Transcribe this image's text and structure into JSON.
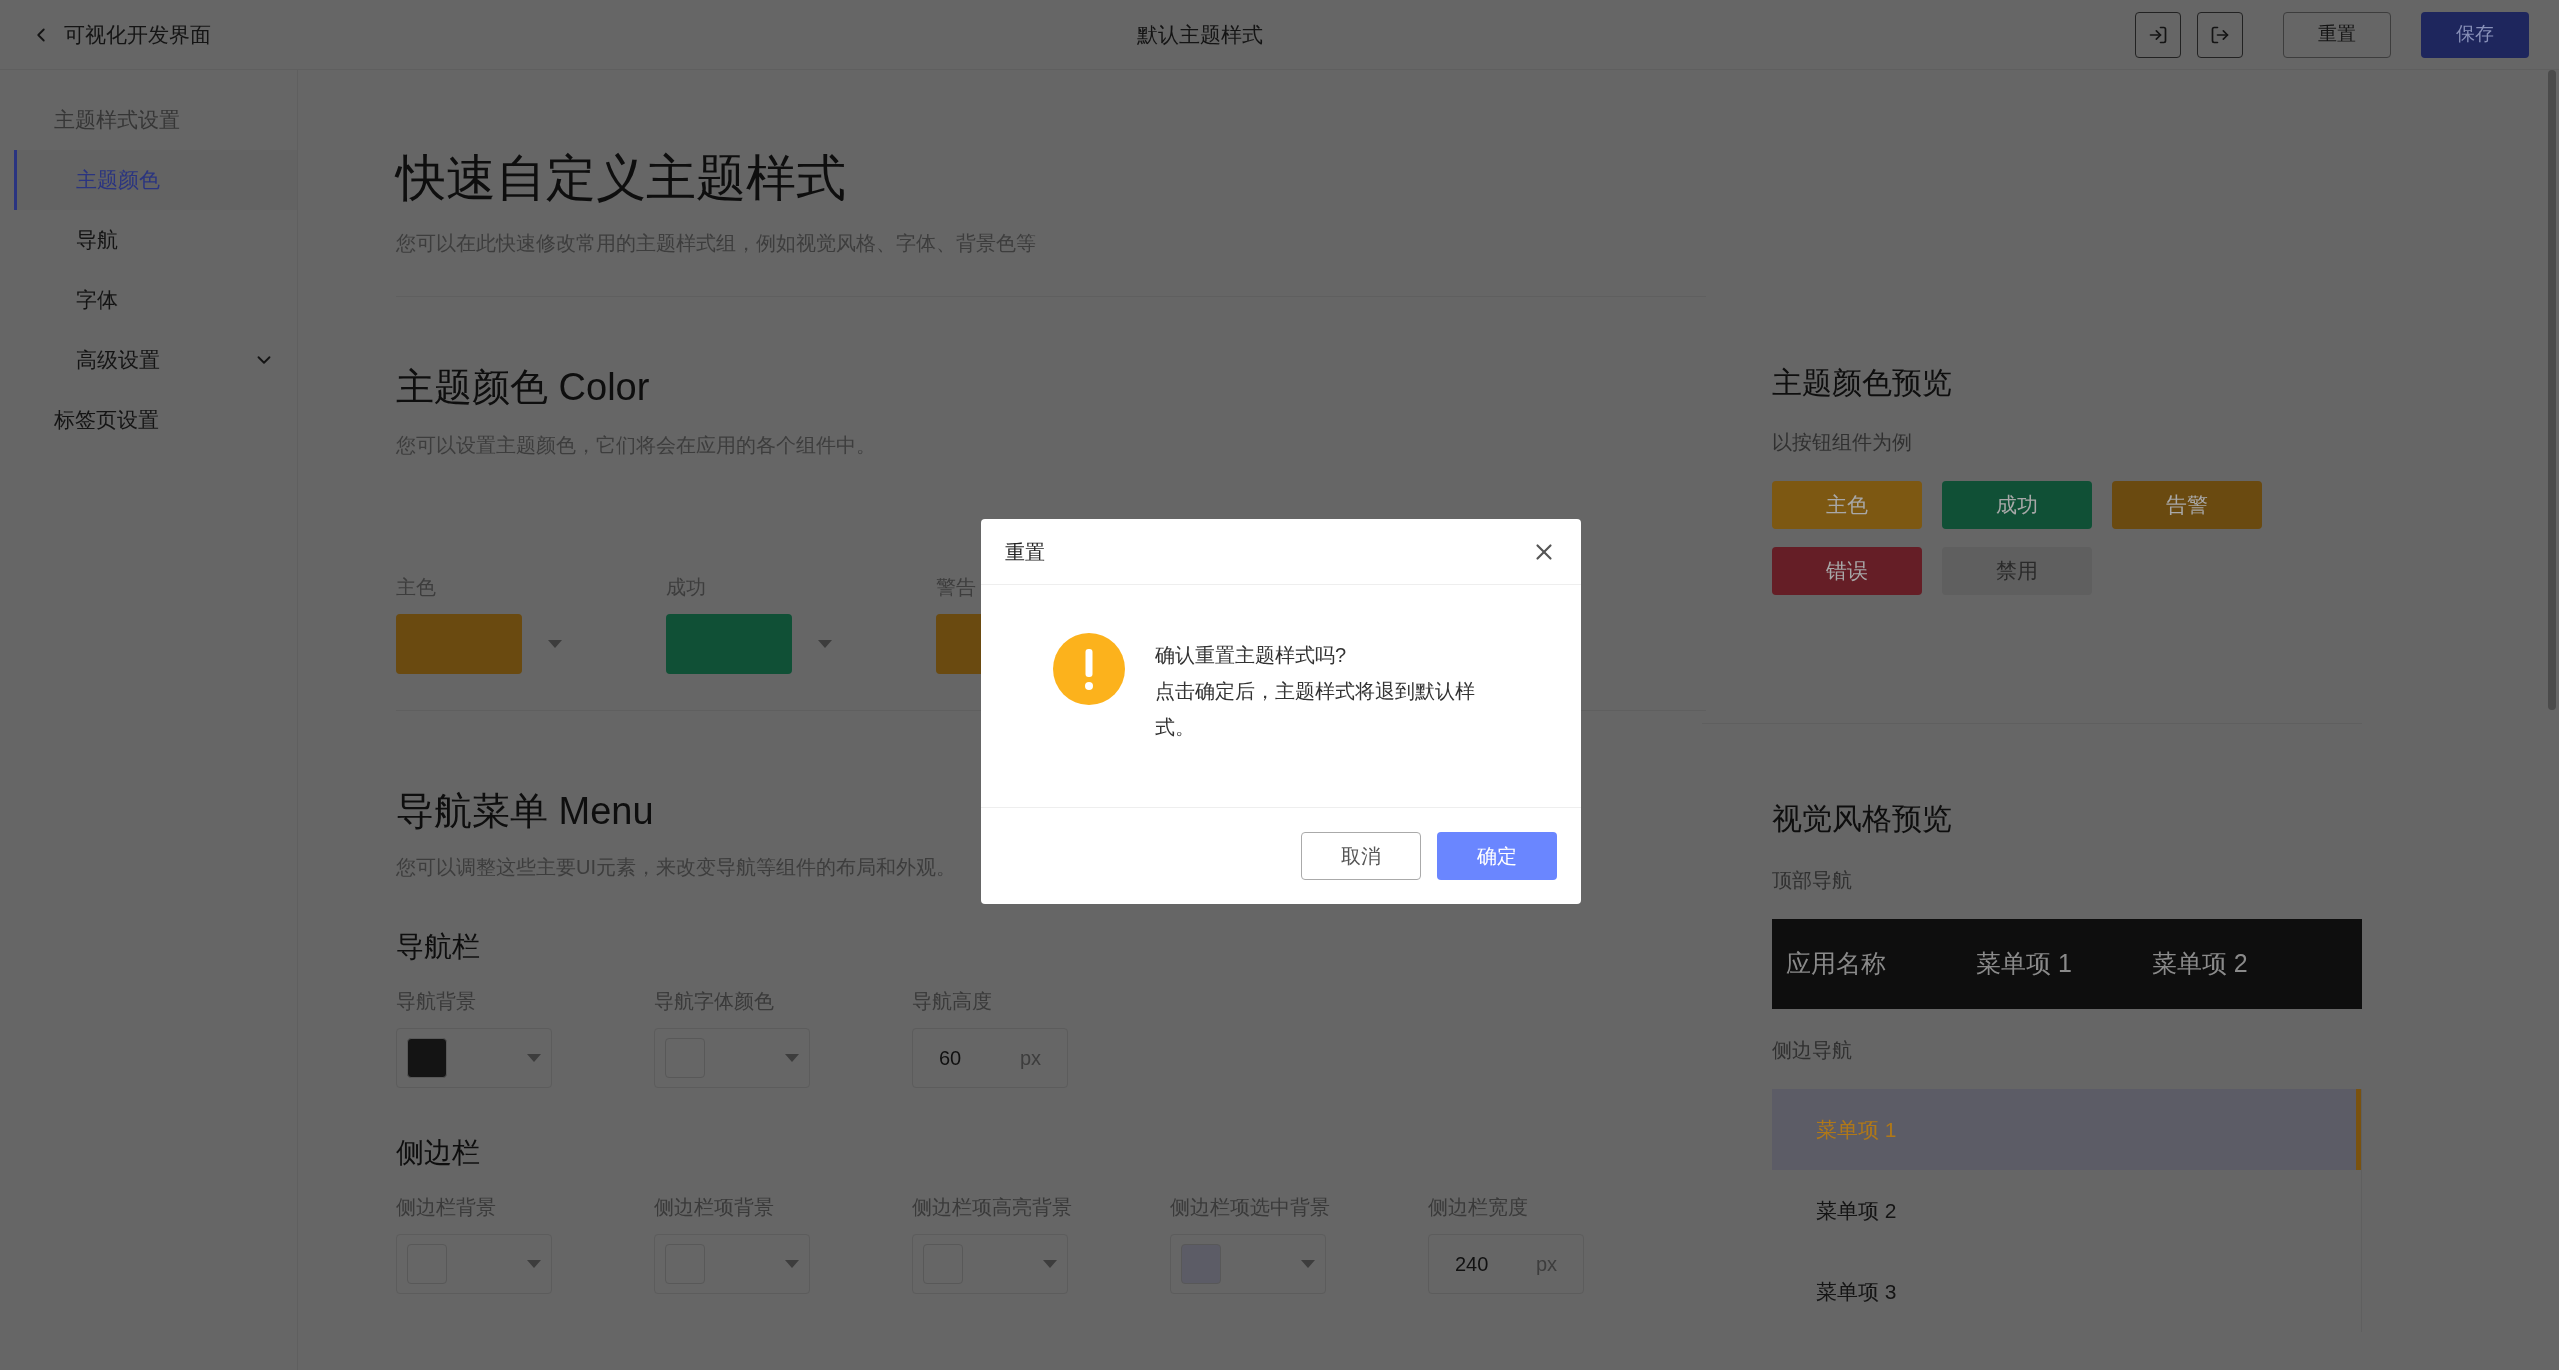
{
  "header": {
    "back_label": "可视化开发界面",
    "title": "默认主题样式",
    "icon_buttons": [
      {
        "kind": "import"
      },
      {
        "kind": "export"
      }
    ],
    "reset_label": "重置",
    "save_label": "保存"
  },
  "sidebar": {
    "items": [
      {
        "label": "主题样式设置",
        "children": [
          {
            "label": "主题颜色",
            "selected": true
          },
          {
            "label": "导航",
            "selected": false
          },
          {
            "label": "字体",
            "selected": false
          },
          {
            "label": "高级设置",
            "selected": false,
            "expanded": false
          }
        ]
      },
      {
        "label": "标签页设置"
      }
    ]
  },
  "intro": {
    "title": "快速自定义主题样式",
    "description": "您可以在此快速修改常用的主题样式组，例如视觉风格、字体、背景色等"
  },
  "color_section": {
    "title": "主题颜色 Color",
    "description": "您可以设置主题颜色，它们将会在应用的各个组件中。",
    "swatches": [
      {
        "label": "主色",
        "color": "#6a4a10"
      },
      {
        "label": "成功",
        "color": "#105036"
      },
      {
        "label": "警告",
        "color": "#6a4a10"
      }
    ]
  },
  "menu_section": {
    "title": "导航菜单 Menu",
    "description": "您可以调整这些主要UI元素，来改变导航等组件的布局和外观。",
    "groups": [
      {
        "title": "导航栏",
        "fields": [
          {
            "label": "导航背景",
            "kind": "color",
            "color": "#141414"
          },
          {
            "label": "导航字体颜色",
            "kind": "color",
            "color": "#666666"
          },
          {
            "label": "导航高度",
            "kind": "number",
            "value": "60",
            "unit": "px"
          }
        ]
      },
      {
        "title": "侧边栏",
        "fields": [
          {
            "label": "侧边栏背景",
            "kind": "color",
            "color": "#666666"
          },
          {
            "label": "侧边栏项背景",
            "kind": "color",
            "color": "#666666"
          },
          {
            "label": "侧边栏项高亮背景",
            "kind": "color",
            "color": "#666666"
          },
          {
            "label": "侧边栏项选中背景",
            "kind": "color",
            "color": "#5c5c66"
          },
          {
            "label": "侧边栏宽度",
            "kind": "number",
            "value": "240",
            "unit": "px"
          }
        ]
      }
    ]
  },
  "color_preview": {
    "title": "主题颜色预览",
    "subtitle": "以按钮组件为例",
    "buttons": [
      {
        "label": "主色",
        "color": "#7d5812",
        "disabled": false
      },
      {
        "label": "成功",
        "color": "#105036",
        "disabled": false
      },
      {
        "label": "告警",
        "color": "#6a4a10",
        "disabled": false
      },
      {
        "label": "错误",
        "color": "#651e26",
        "disabled": false
      },
      {
        "label": "禁用",
        "disabled": true
      }
    ]
  },
  "style_preview": {
    "title": "视觉风格预览",
    "top_nav_label": "顶部导航",
    "top_nav": {
      "app_name": "应用名称",
      "items": [
        "菜单项 1",
        "菜单项 2"
      ]
    },
    "side_nav_label": "侧边导航",
    "side_nav": [
      {
        "label": "菜单项 1",
        "selected": true
      },
      {
        "label": "菜单项 2",
        "selected": false
      },
      {
        "label": "菜单项 3",
        "selected": false
      }
    ]
  },
  "dialog": {
    "title": "重置",
    "lines": [
      "确认重置主题样式吗?",
      "点击确定后，主题样式将退到默认样式。"
    ],
    "cancel_label": "取消",
    "confirm_label": "确定"
  }
}
